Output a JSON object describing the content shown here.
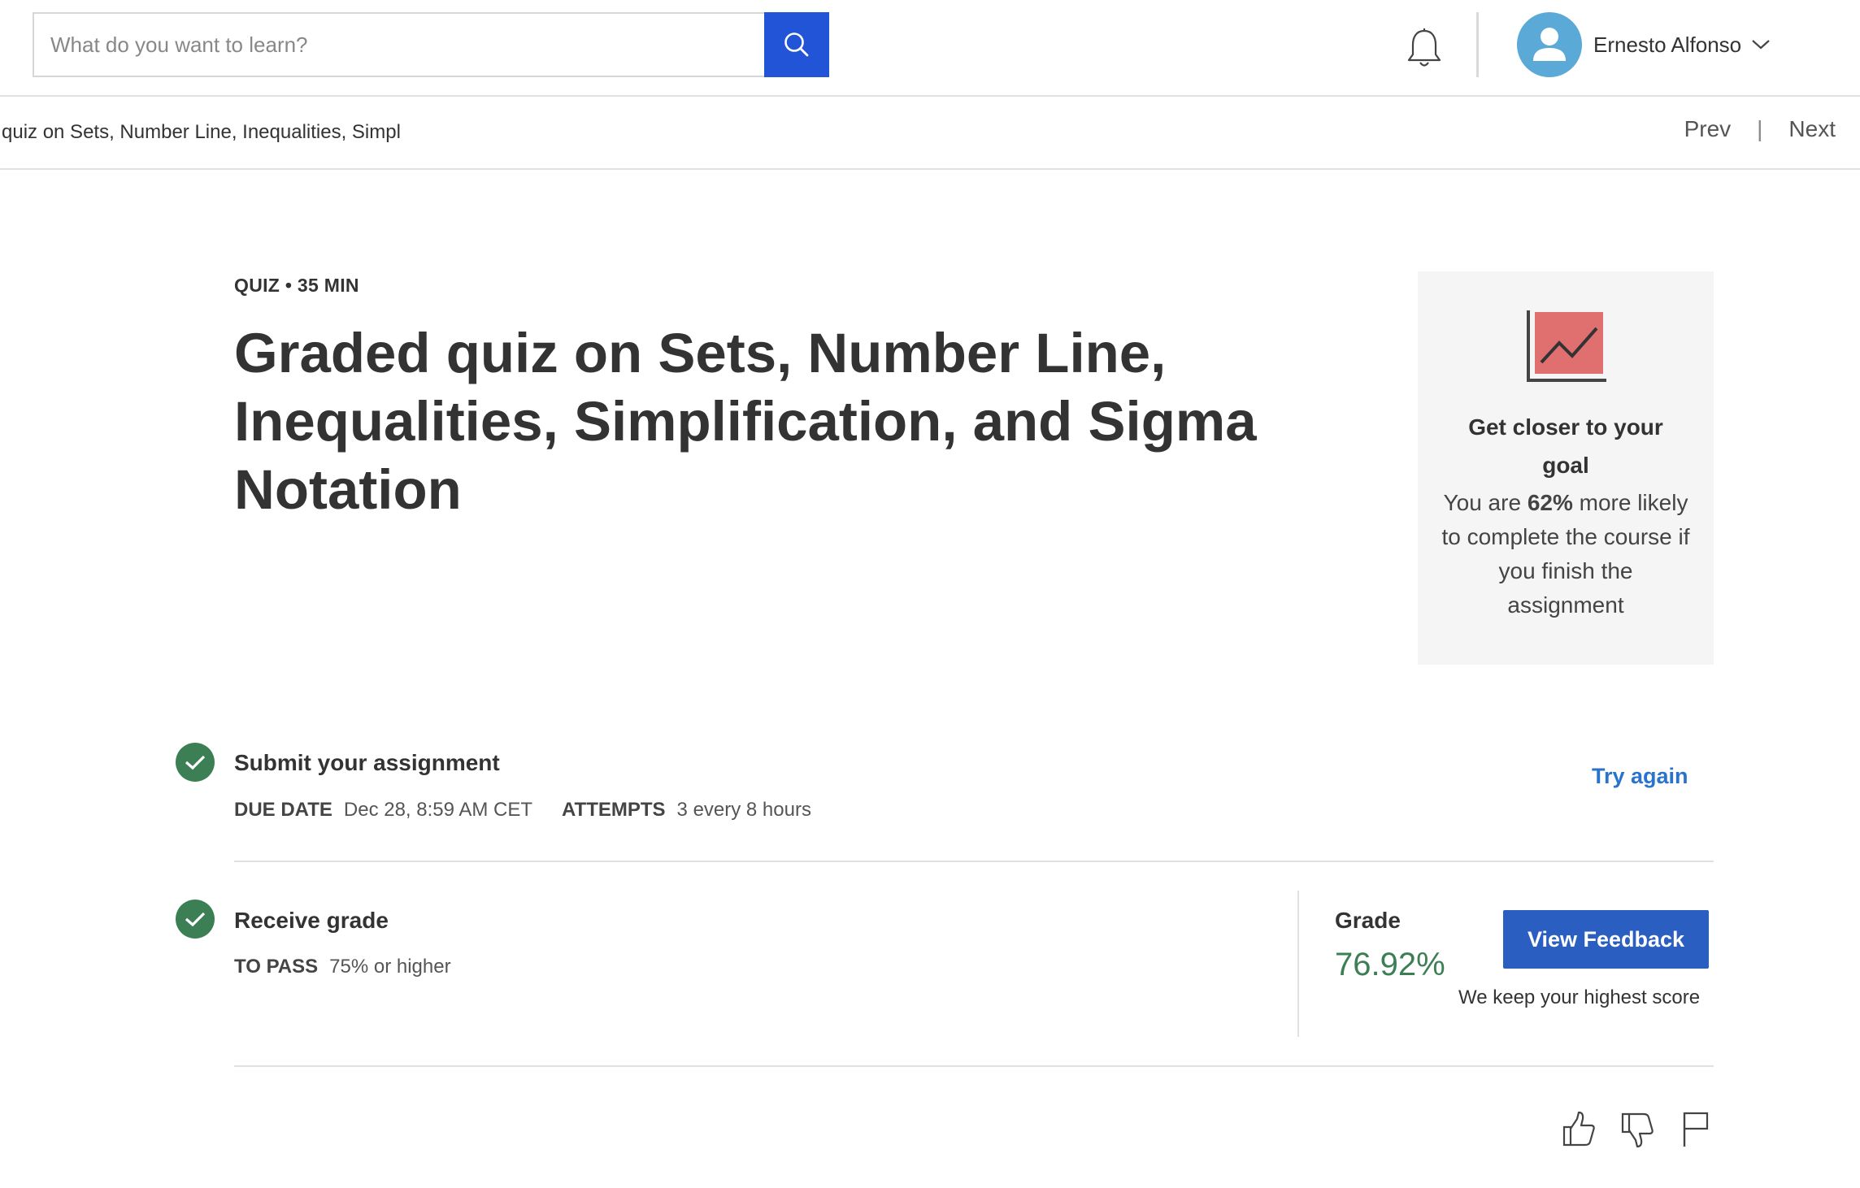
{
  "header": {
    "search": {
      "placeholder": "What do you want to learn?",
      "value": ""
    },
    "user_name": "Ernesto Alfonso"
  },
  "subnav": {
    "title": "l quiz on Sets, Number Line, Inequalities, Simpl",
    "prev_label": "Prev",
    "separator": "|",
    "next_label": "Next"
  },
  "quiz": {
    "meta": "QUIZ • 35 MIN",
    "title": "Graded quiz on Sets, Number Line, Inequalities, Simplification, and Sigma Notation"
  },
  "goal_card": {
    "title": "Get closer to your goal",
    "text_before": "You are ",
    "text_bold": "62%",
    "text_after": " more likely to complete the course if you finish the assignment"
  },
  "steps": {
    "submit": {
      "title": "Submit your assignment",
      "due_label": "DUE DATE",
      "due_value": "Dec 28, 8:59 AM CET",
      "attempts_label": "ATTEMPTS",
      "attempts_value": "3 every 8 hours",
      "action_label": "Try again"
    },
    "receive": {
      "title": "Receive grade",
      "pass_label": "TO PASS",
      "pass_value": "75% or higher",
      "grade_label": "Grade",
      "grade_value": "76.92%",
      "feedback_button": "View Feedback",
      "note": "We keep your highest score"
    }
  },
  "colors": {
    "primary": "#2154d6",
    "button": "#2a5fc1",
    "link": "#2a73cc",
    "success": "#3d7f55",
    "goal_icon": "#e07070",
    "avatar": "#5aa9d6"
  },
  "icons": [
    "search-icon",
    "bell-icon",
    "user-avatar-icon",
    "chevron-down-icon",
    "chart-icon",
    "check-icon",
    "thumbs-up-icon",
    "thumbs-down-icon",
    "flag-icon"
  ]
}
